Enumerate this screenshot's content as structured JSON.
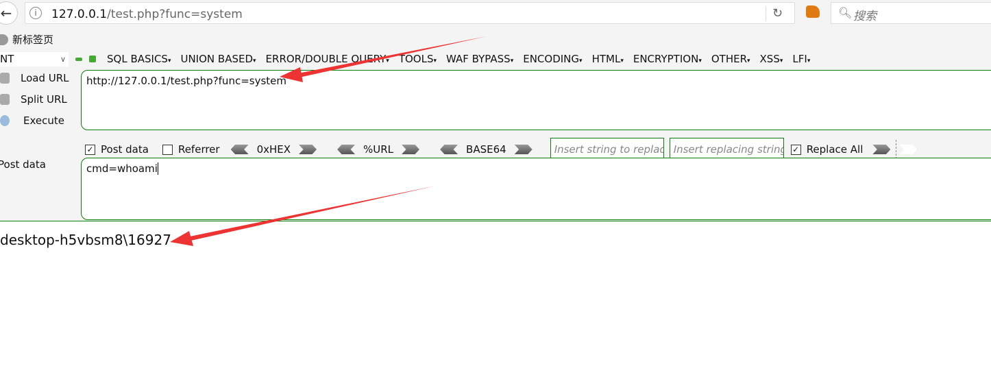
{
  "browser": {
    "url_host": "127.0.0.1",
    "url_path": "/test.php?func=system",
    "search_placeholder": "搜索",
    "bookmark": "新标签页"
  },
  "hackbar": {
    "select_value": "NT",
    "menus": [
      "SQL BASICS",
      "UNION BASED",
      "ERROR/DOUBLE QUERY",
      "TOOLS",
      "WAF BYPASS",
      "ENCODING",
      "HTML",
      "ENCRYPTION",
      "OTHER",
      "XSS",
      "LFI"
    ],
    "load_url": "Load URL",
    "split_url": "Split URL",
    "execute": "Execute",
    "url_value": "http://127.0.0.1/test.php?func=system",
    "post_data_checkbox": "Post data",
    "referrer_checkbox": "Referrer",
    "hex": "0xHEX",
    "urlenc": "%URL",
    "base64": "BASE64",
    "replace_placeholder": "Insert string to replace",
    "replacing_placeholder": "Insert replacing string",
    "replace_all": "Replace All",
    "post_label": "Post data",
    "post_value": "cmd=whoami",
    "post_checked": true,
    "referrer_checked": false,
    "replace_all_checked": true
  },
  "output": "desktop-h5vbsm8\\16927",
  "annotation_color": "#ee3333"
}
